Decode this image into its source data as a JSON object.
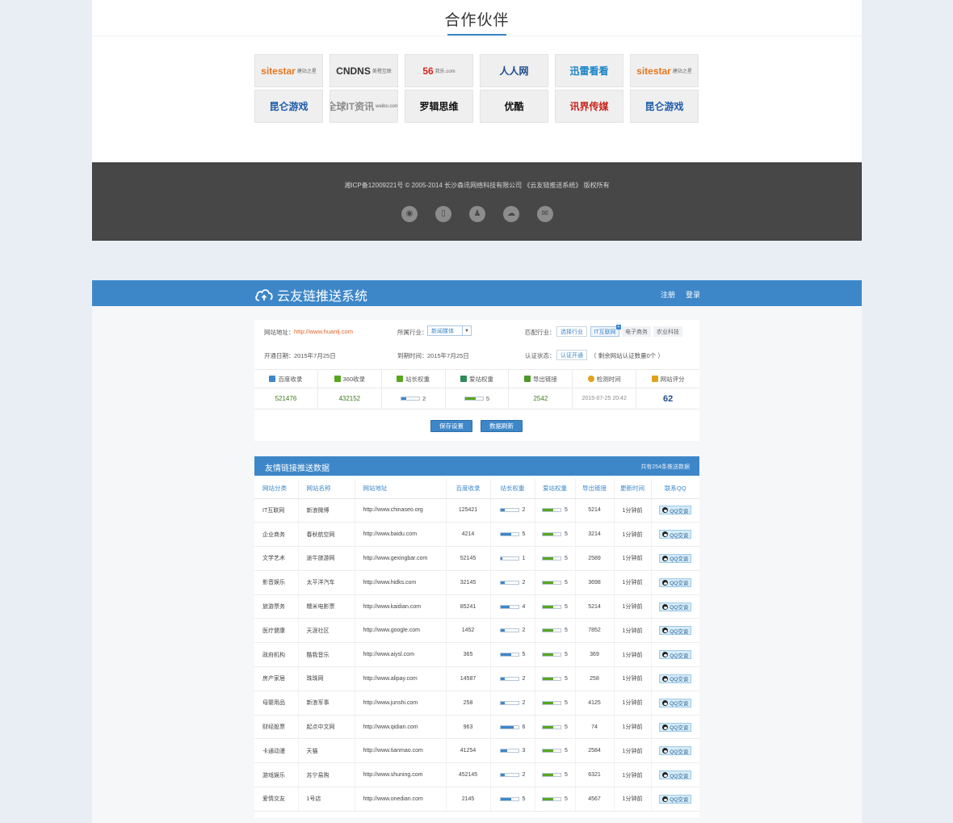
{
  "partners": {
    "title": "合作伙伴",
    "logos": [
      {
        "label": "sitestar",
        "sub": "建站之星",
        "color": "#e8761e"
      },
      {
        "label": "CNDNS",
        "sub": "美橙互联",
        "color": "#333333"
      },
      {
        "label": "56",
        "sub": "我乐.com",
        "color": "#d8241c"
      },
      {
        "label": "人人网",
        "sub": "",
        "color": "#1a4b8c"
      },
      {
        "label": "迅雷看看",
        "sub": "",
        "color": "#1c84c6"
      },
      {
        "label": "sitestar",
        "sub": "建站之星",
        "color": "#e8761e"
      },
      {
        "label": "昆仑游戏",
        "sub": "",
        "color": "#1d5ba8"
      },
      {
        "label": "@全球IT资讯",
        "sub": "weibo.com/gsqit",
        "color": "#8c8c8c"
      },
      {
        "label": "罗辑思维",
        "sub": "",
        "color": "#111111"
      },
      {
        "label": "优酷",
        "sub": "",
        "color": "#111111"
      },
      {
        "label": "讯界传媒",
        "sub": "",
        "color": "#c8241c"
      },
      {
        "label": "昆仑游戏",
        "sub": "",
        "color": "#1d5ba8"
      }
    ]
  },
  "footer": {
    "copyright": "湘ICP备12009221号 © 2005-2014 长沙森讯网络科技有限公司 《云友链推送系统》 版权所有",
    "icons": [
      "weibo-icon",
      "mobile-icon",
      "qq-icon",
      "wechat-icon",
      "mail-icon"
    ]
  },
  "app": {
    "brand": "云友链推送系统",
    "register": "注册",
    "login": "登录"
  },
  "settings": {
    "site_url_label": "网站地址：",
    "site_url": "http://www.huanlj.com",
    "industry_label": "所属行业：",
    "industry_value": "新闻媒体",
    "match_label": "匹配行业：",
    "match_select": "选择行业",
    "match_tags": [
      "IT互联网",
      "电子商务",
      "农业科技"
    ],
    "open_date_label": "开通日期：",
    "open_date": "2015年7月25日",
    "expire_label": "到期时间：",
    "expire_date": "2015年7月25日",
    "auth_label": "认证状态：",
    "auth_button": "认证开通",
    "auth_note": "（ 剩余网站认证数量0个 ）",
    "stat_heads": [
      "百度收录",
      "360收录",
      "站长权重",
      "爱站权重",
      "导出链接",
      "检测时间",
      "网站评分"
    ],
    "stat_values": {
      "baidu": "521476",
      "s360": "432152",
      "zz_weight": "2",
      "zz_weight_level": 0.25,
      "az_weight": "5",
      "az_weight_level": 0.6,
      "links": "2542",
      "check_time": "2015-07-25 20:42",
      "score": "62"
    },
    "save_button": "保存设置",
    "refresh_button": "数据刷新"
  },
  "push_table": {
    "title": "友情链接推送数据",
    "count": "共有254条推送数据",
    "columns": [
      "网站分类",
      "网站名称",
      "网站地址",
      "百度收录",
      "站长权重",
      "爱站权重",
      "导出链接",
      "更新时间",
      "联系QQ"
    ],
    "qq_label": "QQ交谈",
    "rows": [
      {
        "cat": "IT互联网",
        "name": "新浪微博",
        "url": "http://www.chinaseo.org",
        "baidu": "125421",
        "zz": "2",
        "zz_level": 0.25,
        "az": "5",
        "az_level": 0.6,
        "links": "5214",
        "time": "1分钟前"
      },
      {
        "cat": "企业商务",
        "name": "春秋航空网",
        "url": "http://www.baidu.com",
        "baidu": "4214",
        "zz": "5",
        "zz_level": 0.6,
        "az": "5",
        "az_level": 0.6,
        "links": "3214",
        "time": "1分钟前"
      },
      {
        "cat": "文学艺术",
        "name": "途牛旅游网",
        "url": "http://www.gexingbar.com",
        "baidu": "52145",
        "zz": "1",
        "zz_level": 0.1,
        "az": "5",
        "az_level": 0.6,
        "links": "2589",
        "time": "1分钟前"
      },
      {
        "cat": "影音娱乐",
        "name": "太平洋汽车",
        "url": "http://www.hidks.com",
        "baidu": "32145",
        "zz": "2",
        "zz_level": 0.25,
        "az": "5",
        "az_level": 0.6,
        "links": "3698",
        "time": "1分钟前"
      },
      {
        "cat": "旅游票务",
        "name": "糯米电影票",
        "url": "http://www.kaidian.com",
        "baidu": "85241",
        "zz": "4",
        "zz_level": 0.5,
        "az": "5",
        "az_level": 0.6,
        "links": "5214",
        "time": "1分钟前"
      },
      {
        "cat": "医疗健康",
        "name": "天涯社区",
        "url": "http://www.google.com",
        "baidu": "1452",
        "zz": "2",
        "zz_level": 0.25,
        "az": "5",
        "az_level": 0.6,
        "links": "7852",
        "time": "1分钟前"
      },
      {
        "cat": "政府机构",
        "name": "酷我音乐",
        "url": "http://www.aiysl.com",
        "baidu": "365",
        "zz": "5",
        "zz_level": 0.6,
        "az": "5",
        "az_level": 0.6,
        "links": "369",
        "time": "1分钟前"
      },
      {
        "cat": "房产家居",
        "name": "珠珠网",
        "url": "http://www.alipay.com",
        "baidu": "14587",
        "zz": "2",
        "zz_level": 0.25,
        "az": "5",
        "az_level": 0.6,
        "links": "258",
        "time": "1分钟前"
      },
      {
        "cat": "母婴用品",
        "name": "新浪军事",
        "url": "http://www.junshi.com",
        "baidu": "258",
        "zz": "2",
        "zz_level": 0.25,
        "az": "5",
        "az_level": 0.6,
        "links": "4125",
        "time": "1分钟前"
      },
      {
        "cat": "财经股票",
        "name": "起点中文网",
        "url": "http://www.qidian.com",
        "baidu": "963",
        "zz": "6",
        "zz_level": 0.75,
        "az": "5",
        "az_level": 0.6,
        "links": "74",
        "time": "1分钟前"
      },
      {
        "cat": "卡通动漫",
        "name": "天猫",
        "url": "http://www.tianmao.com",
        "baidu": "41254",
        "zz": "3",
        "zz_level": 0.4,
        "az": "5",
        "az_level": 0.6,
        "links": "2584",
        "time": "1分钟前"
      },
      {
        "cat": "游戏娱乐",
        "name": "苏宁易购",
        "url": "http://www.shuning.com",
        "baidu": "452145",
        "zz": "2",
        "zz_level": 0.25,
        "az": "5",
        "az_level": 0.6,
        "links": "6321",
        "time": "1分钟前"
      },
      {
        "cat": "爱情交友",
        "name": "1号店",
        "url": "http://www.onedian.com",
        "baidu": "2145",
        "zz": "5",
        "zz_level": 0.6,
        "az": "5",
        "az_level": 0.6,
        "links": "4567",
        "time": "1分钟前"
      }
    ]
  },
  "colors": {
    "primary": "#3d87c9",
    "footer_bg": "#474747",
    "weight_blue": "#3d87c9",
    "weight_green": "#58a61e",
    "url_orange": "#e0632b",
    "page_bg": "#e9eef4"
  }
}
